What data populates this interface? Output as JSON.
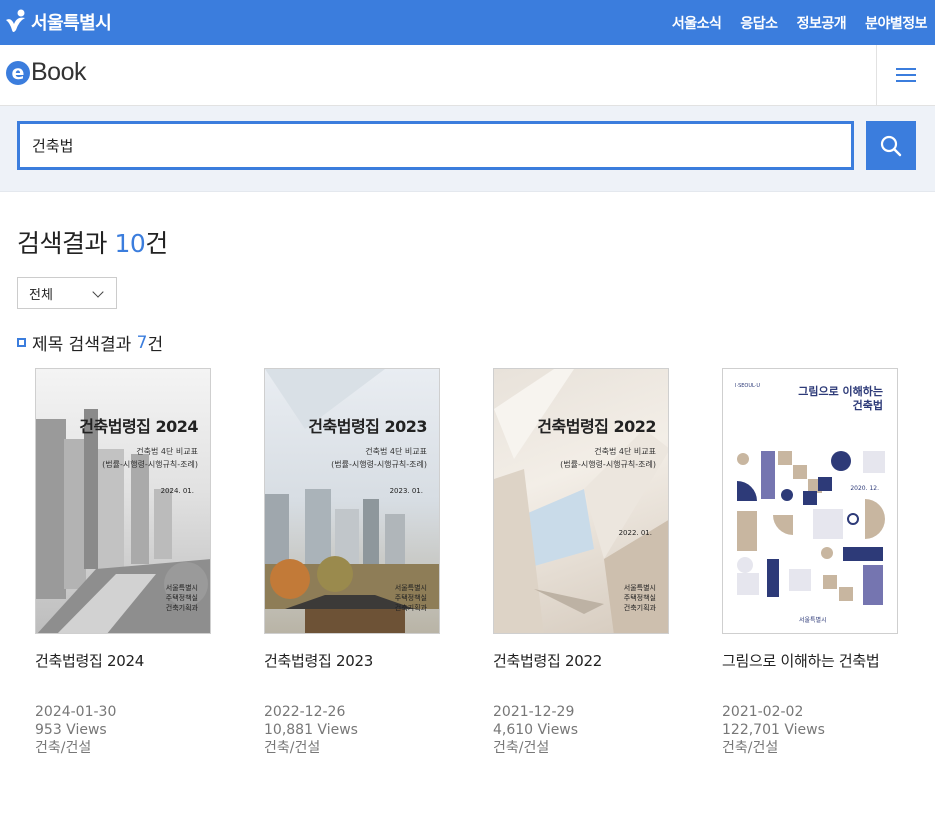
{
  "topbar": {
    "logo_text": "서울특별시",
    "nav": [
      "서울소식",
      "응답소",
      "정보공개",
      "분야별정보"
    ]
  },
  "header": {
    "logo_e": "e",
    "logo_book": "Book",
    "menu_icon": "hamburger-menu-icon"
  },
  "search": {
    "value": "건축법",
    "button_icon": "search-icon"
  },
  "results": {
    "label": "검색결과",
    "count": "10",
    "unit": "건"
  },
  "filter": {
    "selected": "전체"
  },
  "section": {
    "label": "제목 검색결과",
    "count": "7",
    "unit": "건"
  },
  "books": [
    {
      "title": "건축법령집 2024",
      "date": "2024-01-30",
      "views": "953 Views",
      "category": "건축/건설",
      "cover": {
        "title": "건축법령집 2024",
        "sub1": "건축법 4단 비교표",
        "sub2": "(법률-시행령-시행규칙-조례)",
        "date": "2024. 01.",
        "pub1": "서울특별시",
        "pub2": "주택정책실",
        "pub3": "건축기획과"
      }
    },
    {
      "title": "건축법령집 2023",
      "date": "2022-12-26",
      "views": "10,881 Views",
      "category": "건축/건설",
      "cover": {
        "title": "건축법령집 2023",
        "sub1": "건축법 4단 비교표",
        "sub2": "(법률-시행령-시행규칙-조례)",
        "date": "2023. 01.",
        "pub1": "서울특별시",
        "pub2": "주택정책실",
        "pub3": "건축기획과"
      }
    },
    {
      "title": "건축법령집 2022",
      "date": "2021-12-29",
      "views": "4,610 Views",
      "category": "건축/건설",
      "cover": {
        "title": "건축법령집 2022",
        "sub1": "건축법 4단 비교표",
        "sub2": "(법률-시행령-시행규칙-조례)",
        "date": "2022. 01.",
        "pub1": "서울특별시",
        "pub2": "주택정책실",
        "pub3": "건축기획과"
      }
    },
    {
      "title": "그림으로 이해하는 건축법",
      "date": "2021-02-02",
      "views": "122,701 Views",
      "category": "건축/건설",
      "cover": {
        "brand": "I·SEOUL·U",
        "title1": "그림으로 이해하는",
        "title2": "건축법",
        "date": "2020. 12.",
        "pub": "서울특별시"
      }
    }
  ],
  "colors": {
    "accent": "#3b7ddd",
    "search_bg": "#eef2f8",
    "meta_text": "#777777",
    "navy": "#2d3a78",
    "tan": "#c8b6a0"
  }
}
